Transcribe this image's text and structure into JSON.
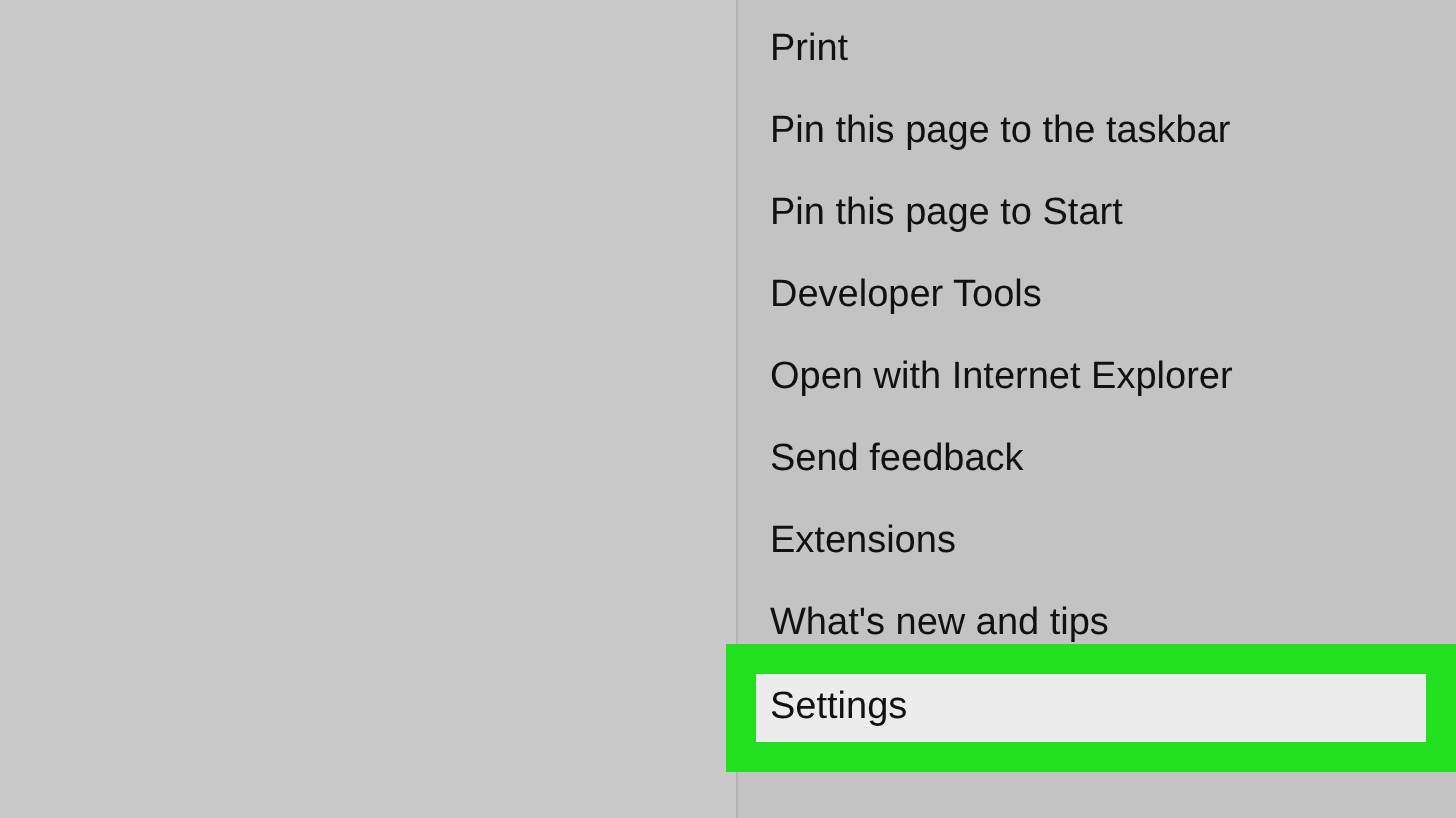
{
  "menu": {
    "items": [
      {
        "label": "Print",
        "selected": false
      },
      {
        "label": "Pin this page to the taskbar",
        "selected": false
      },
      {
        "label": "Pin this page to Start",
        "selected": false
      },
      {
        "label": "Developer Tools",
        "selected": false
      },
      {
        "label": "Open with Internet Explorer",
        "selected": false
      },
      {
        "label": "Send feedback",
        "selected": false
      },
      {
        "label": "Extensions",
        "selected": false
      },
      {
        "label": "What's new and tips",
        "selected": false
      },
      {
        "label": "Settings",
        "selected": true
      }
    ]
  }
}
